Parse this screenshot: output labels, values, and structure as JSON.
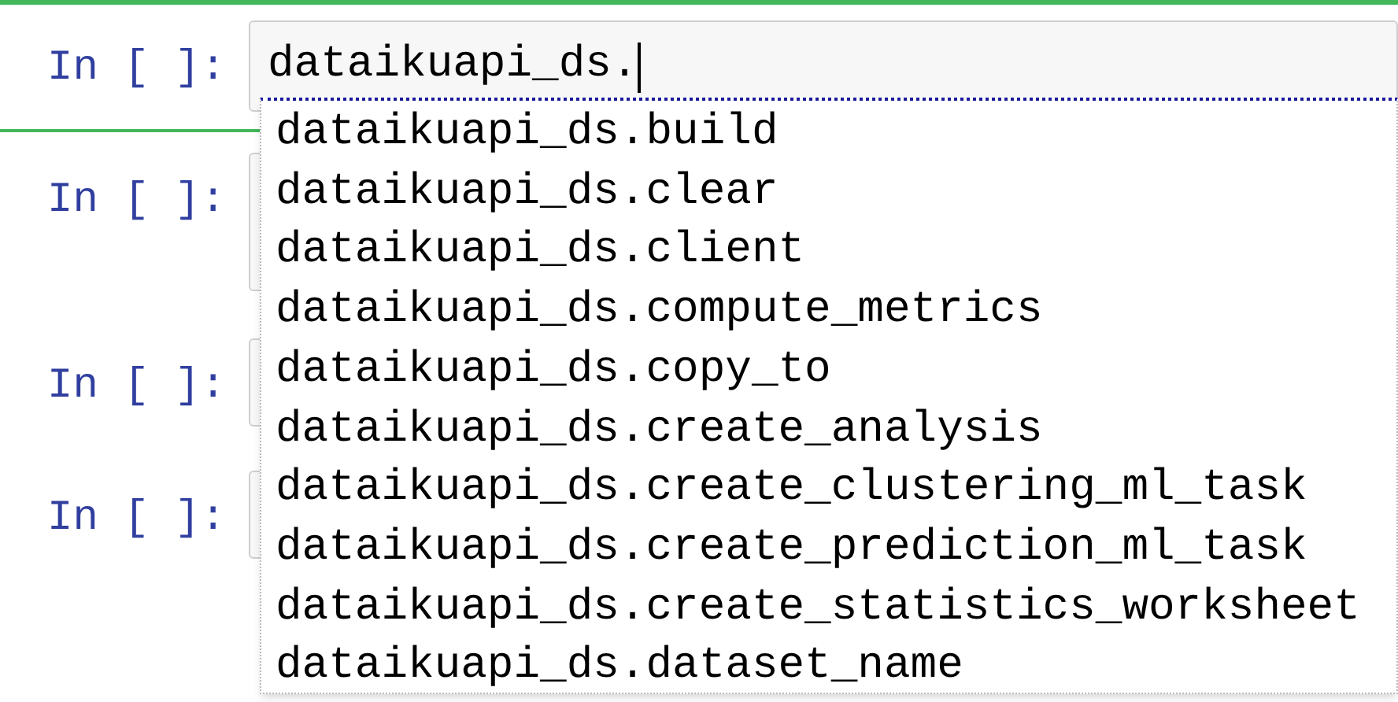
{
  "cells": [
    {
      "prompt": "In [ ]:",
      "value": "dataikuapi_ds.",
      "selected": true
    },
    {
      "prompt": "In [ ]:",
      "selected": false
    },
    {
      "prompt": "In [ ]:",
      "selected": false
    },
    {
      "prompt": "In [ ]:",
      "selected": false
    }
  ],
  "completions": [
    "dataikuapi_ds.build",
    "dataikuapi_ds.clear",
    "dataikuapi_ds.client",
    "dataikuapi_ds.compute_metrics",
    "dataikuapi_ds.copy_to",
    "dataikuapi_ds.create_analysis",
    "dataikuapi_ds.create_clustering_ml_task",
    "dataikuapi_ds.create_prediction_ml_task",
    "dataikuapi_ds.create_statistics_worksheet",
    "dataikuapi_ds.dataset_name"
  ]
}
